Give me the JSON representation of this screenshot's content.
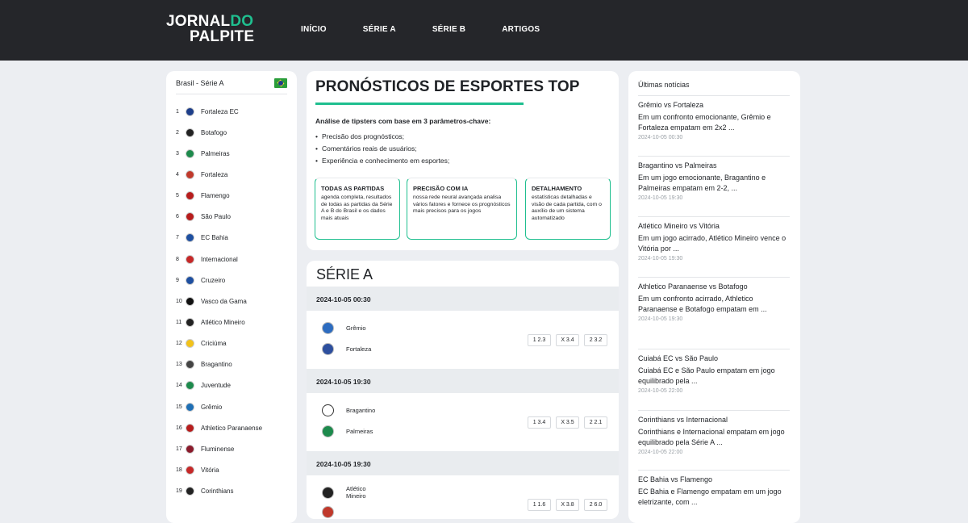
{
  "brand": {
    "logo_line1_a": "JORNAL",
    "logo_line1_b": "DO",
    "logo_line2": "PALPITE"
  },
  "nav": [
    "INÍCIO",
    "SÉRIE A",
    "SÉRIE B",
    "ARTIGOS"
  ],
  "standings": {
    "title": "Brasil - Série A",
    "teams": [
      {
        "pos": "1",
        "name": "Fortaleza EC"
      },
      {
        "pos": "2",
        "name": "Botafogo"
      },
      {
        "pos": "3",
        "name": "Palmeiras"
      },
      {
        "pos": "4",
        "name": "Fortaleza"
      },
      {
        "pos": "5",
        "name": "Flamengo"
      },
      {
        "pos": "6",
        "name": "São Paulo"
      },
      {
        "pos": "7",
        "name": "EC Bahia"
      },
      {
        "pos": "8",
        "name": "Internacional"
      },
      {
        "pos": "9",
        "name": "Cruzeiro"
      },
      {
        "pos": "10",
        "name": "Vasco da Gama"
      },
      {
        "pos": "11",
        "name": "Atlético Mineiro"
      },
      {
        "pos": "12",
        "name": "Criciúma"
      },
      {
        "pos": "13",
        "name": "Bragantino"
      },
      {
        "pos": "14",
        "name": "Juventude"
      },
      {
        "pos": "15",
        "name": "Grêmio"
      },
      {
        "pos": "16",
        "name": "Athletico Paranaense"
      },
      {
        "pos": "17",
        "name": "Fluminense"
      },
      {
        "pos": "18",
        "name": "Vitória"
      },
      {
        "pos": "19",
        "name": "Corinthians"
      }
    ]
  },
  "hero": {
    "title": "PRONÓSTICOS DE ESPORTES TOP",
    "intro": "Análise de tipsters com base em 3 parâmetros-chave:",
    "bullets": [
      "Precisão dos prognósticos;",
      "Comentários reais de usuários;",
      "Experiência e conhecimento em esportes;"
    ],
    "features": [
      {
        "title": "TODAS AS PARTIDAS",
        "desc": "agenda completa, resultados de todas as partidas da Série A e B do Brasil e os dados mais atuais"
      },
      {
        "title": "PRECISÃO COM IA",
        "desc": "nossa rede neural avançada analisa vários fatores e fornece os prognósticos mais precisos para os jogos"
      },
      {
        "title": "DETALHAMENTO",
        "desc": "estatísticas detalhadas e visão de cada partida, com o auxílio de um sistema automatizado"
      }
    ]
  },
  "serie_a": {
    "title": "SÉRIE A",
    "matches": [
      {
        "date": "2024-10-05 00:30",
        "home": "Grêmio",
        "away": "Fortaleza",
        "odds": [
          "1 2.3",
          "X 3.4",
          "2 3.2"
        ]
      },
      {
        "date": "2024-10-05 19:30",
        "home": "Bragantino",
        "away": "Palmeiras",
        "odds": [
          "1 3.4",
          "X 3.5",
          "2 2.1"
        ]
      },
      {
        "date": "2024-10-05 19:30",
        "home": "Atlético Mineiro",
        "away": "",
        "odds": [
          "1 1.6",
          "X 3.8",
          "2 6.0"
        ]
      }
    ]
  },
  "news": {
    "title": "Últimas notícias",
    "items": [
      {
        "title": "Grêmio vs Fortaleza",
        "desc": "Em um confronto emocionante, Grêmio e Fortaleza empatam em 2x2 ...",
        "date": "2024-10-05 00:30"
      },
      {
        "title": "Bragantino vs Palmeiras",
        "desc": "Em um jogo emocionante, Bragantino e Palmeiras empatam em 2-2, ...",
        "date": "2024-10-05 19:30"
      },
      {
        "title": "Atlético Mineiro vs Vitória",
        "desc": "Em um jogo acirrado, Atlético Mineiro vence o Vitória por ...",
        "date": "2024-10-05 19:30"
      },
      {
        "title": "Athletico Paranaense vs Botafogo",
        "desc": "Em um confronto acirrado, Athletico Paranaense e Botafogo empatam em ...",
        "date": "2024-10-05 19:30"
      },
      {
        "title": "Cuiabá EC vs São Paulo",
        "desc": "Cuiabá EC e São Paulo empatam em jogo equilibrado pela ...",
        "date": "2024-10-05 22:00"
      },
      {
        "title": "Corinthians vs Internacional",
        "desc": "Corinthians e Internacional empatam em jogo equilibrado pela Série A ...",
        "date": "2024-10-05 22:00"
      },
      {
        "title": "EC Bahia vs Flamengo",
        "desc": "EC Bahia e Flamengo empatam em um jogo eletrizante, com ...",
        "date": ""
      }
    ]
  },
  "colors": {
    "accent": "#1fbf8f",
    "topbar": "#25262a",
    "page_bg": "#eceef2"
  }
}
